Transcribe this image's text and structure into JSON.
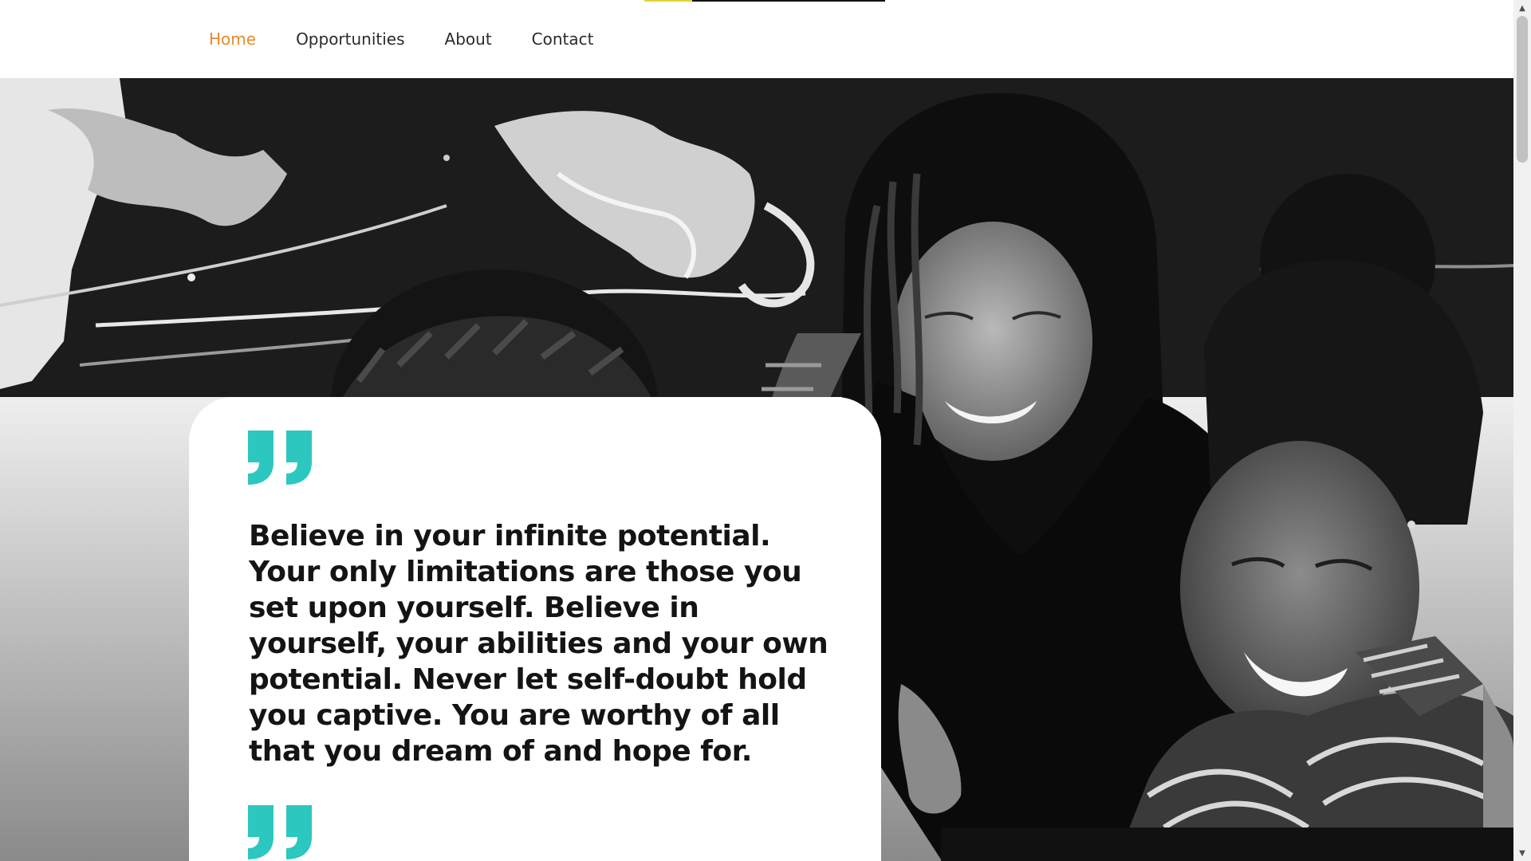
{
  "nav": {
    "items": [
      {
        "label": "Home",
        "active": true
      },
      {
        "label": "Opportunities",
        "active": false
      },
      {
        "label": "About",
        "active": false
      },
      {
        "label": "Contact",
        "active": false
      }
    ]
  },
  "hero": {
    "image_description": "black-and-white photo of three smiling women looking at a laptop"
  },
  "quote": {
    "text": "Believe in your infinite potential. Your only limitations are those you set upon yourself. Believe in yourself, your abilities and your own potential. Never let self-doubt hold you captive. You are worthy of all that you dream of and hope for.",
    "open_icon": "quote-open-icon",
    "close_icon": "quote-close-icon"
  },
  "colors": {
    "nav_active": "#e8892c",
    "nav_text": "#2b2b2b",
    "quote_mark": "#2cc7bf",
    "quote_text": "#141414",
    "loader_done": "#e0d43a"
  },
  "scrollbar": {
    "up_icon": "scroll-up-arrow-icon",
    "down_icon": "scroll-down-arrow-icon"
  }
}
